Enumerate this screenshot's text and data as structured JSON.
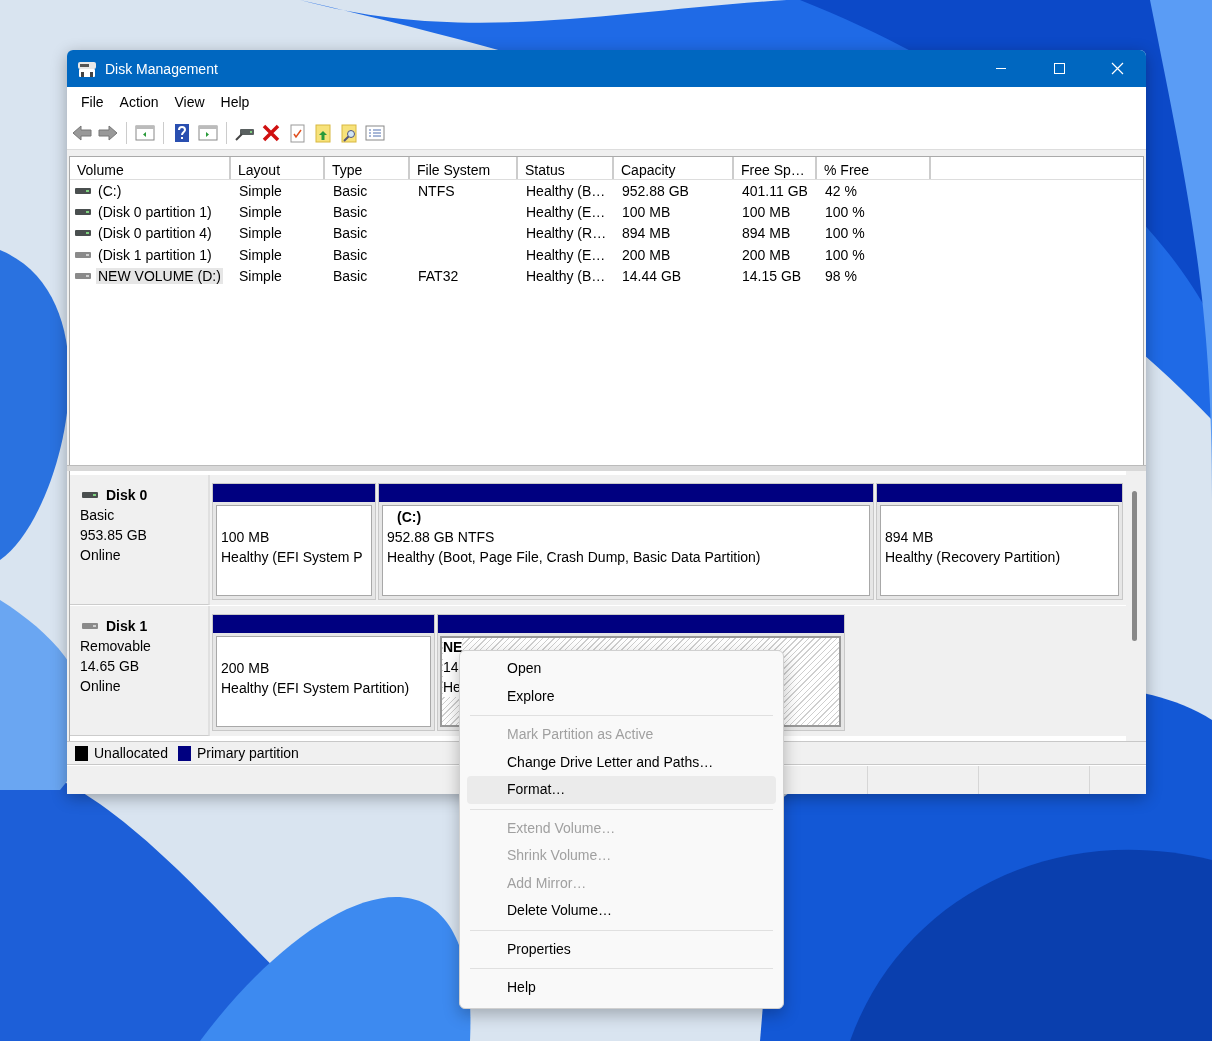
{
  "window": {
    "title": "Disk Management"
  },
  "menu_bar": [
    {
      "label": "File"
    },
    {
      "label": "Action"
    },
    {
      "label": "View"
    },
    {
      "label": "Help"
    }
  ],
  "volume_table": {
    "columns": [
      "Volume",
      "Layout",
      "Type",
      "File System",
      "Status",
      "Capacity",
      "Free Sp…",
      "% Free"
    ],
    "rows": [
      {
        "cells": [
          "(C:)",
          "Simple",
          "Basic",
          "NTFS",
          "Healthy (B…",
          "952.88 GB",
          "401.11 GB",
          "42 %"
        ],
        "selected": false
      },
      {
        "cells": [
          "(Disk 0 partition 1)",
          "Simple",
          "Basic",
          "",
          "Healthy (E…",
          "100 MB",
          "100 MB",
          "100 %"
        ],
        "selected": false
      },
      {
        "cells": [
          "(Disk 0 partition 4)",
          "Simple",
          "Basic",
          "",
          "Healthy (R…",
          "894 MB",
          "894 MB",
          "100 %"
        ],
        "selected": false
      },
      {
        "cells": [
          "(Disk 1 partition 1)",
          "Simple",
          "Basic",
          "",
          "Healthy (E…",
          "200 MB",
          "200 MB",
          "100 %"
        ],
        "selected": false
      },
      {
        "cells": [
          "NEW VOLUME (D:)",
          "Simple",
          "Basic",
          "FAT32",
          "Healthy (B…",
          "14.44 GB",
          "14.15 GB",
          "98 %"
        ],
        "selected": true
      }
    ]
  },
  "disks": [
    {
      "name": "Disk 0",
      "type": "Basic",
      "size": "953.85 GB",
      "status": "Online",
      "partitions": [
        {
          "size": "100 MB",
          "status": "Healthy (EFI System P",
          "selected": false
        },
        {
          "label": "(C:)",
          "size": "952.88 GB NTFS",
          "status": "Healthy (Boot, Page File, Crash Dump, Basic Data Partition)",
          "selected": false
        },
        {
          "size": "894 MB",
          "status": "Healthy (Recovery Partition)",
          "selected": false
        }
      ]
    },
    {
      "name": "Disk 1",
      "type": "Removable",
      "size": "14.65 GB",
      "status": "Online",
      "partitions": [
        {
          "size": "200 MB",
          "status": "Healthy (EFI System Partition)",
          "selected": false
        },
        {
          "label": "NE",
          "size": "14",
          "status": "He",
          "selected": true
        }
      ]
    }
  ],
  "legend": [
    {
      "label": "Unallocated",
      "color": "#000000"
    },
    {
      "label": "Primary partition",
      "color": "#000080"
    }
  ],
  "context_menu": [
    {
      "kind": "item",
      "label": "Open",
      "disabled": false,
      "selected": false
    },
    {
      "kind": "item",
      "label": "Explore",
      "disabled": false,
      "selected": false
    },
    {
      "kind": "separator"
    },
    {
      "kind": "item",
      "label": "Mark Partition as Active",
      "disabled": true,
      "selected": false
    },
    {
      "kind": "item",
      "label": "Change Drive Letter and Paths…",
      "disabled": false,
      "selected": false
    },
    {
      "kind": "item",
      "label": "Format…",
      "disabled": false,
      "selected": true
    },
    {
      "kind": "separator"
    },
    {
      "kind": "item",
      "label": "Extend Volume…",
      "disabled": true,
      "selected": false
    },
    {
      "kind": "item",
      "label": "Shrink Volume…",
      "disabled": true,
      "selected": false
    },
    {
      "kind": "item",
      "label": "Add Mirror…",
      "disabled": true,
      "selected": false
    },
    {
      "kind": "item",
      "label": "Delete Volume…",
      "disabled": false,
      "selected": false
    },
    {
      "kind": "separator"
    },
    {
      "kind": "item",
      "label": "Properties",
      "disabled": false,
      "selected": false
    },
    {
      "kind": "separator"
    },
    {
      "kind": "item",
      "label": "Help",
      "disabled": false,
      "selected": false
    }
  ]
}
